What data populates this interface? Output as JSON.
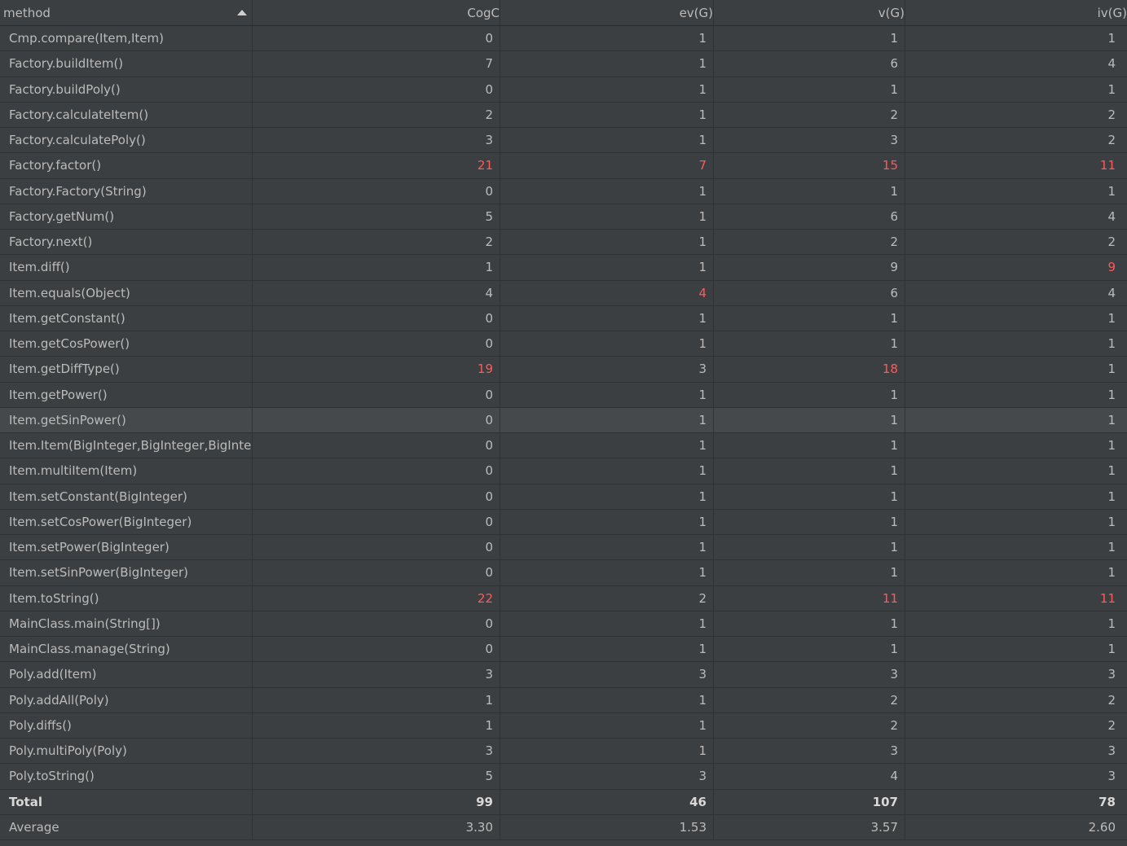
{
  "header": {
    "columns": [
      "method",
      "CogC",
      "ev(G)",
      "v(G)",
      "iv(G)"
    ]
  },
  "colors": {
    "background": "#3c3f41",
    "text": "#bbbbbb",
    "highlight": "#ff5a5a",
    "accent": "#4a88c7"
  },
  "rows": [
    {
      "method": "Cmp.compare(Item,Item)",
      "cogc": "0",
      "ev": "1",
      "v": "1",
      "iv": "1"
    },
    {
      "method": "Factory.buildItem()",
      "cogc": "7",
      "ev": "1",
      "v": "6",
      "iv": "4"
    },
    {
      "method": "Factory.buildPoly()",
      "cogc": "0",
      "ev": "1",
      "v": "1",
      "iv": "1"
    },
    {
      "method": "Factory.calculateItem()",
      "cogc": "2",
      "ev": "1",
      "v": "2",
      "iv": "2"
    },
    {
      "method": "Factory.calculatePoly()",
      "cogc": "3",
      "ev": "1",
      "v": "3",
      "iv": "2"
    },
    {
      "method": "Factory.factor()",
      "cogc": "21",
      "ev": "7",
      "v": "15",
      "iv": "11",
      "red": [
        "cogc",
        "ev",
        "v",
        "iv"
      ]
    },
    {
      "method": "Factory.Factory(String)",
      "cogc": "0",
      "ev": "1",
      "v": "1",
      "iv": "1"
    },
    {
      "method": "Factory.getNum()",
      "cogc": "5",
      "ev": "1",
      "v": "6",
      "iv": "4"
    },
    {
      "method": "Factory.next()",
      "cogc": "2",
      "ev": "1",
      "v": "2",
      "iv": "2"
    },
    {
      "method": "Item.diff()",
      "cogc": "1",
      "ev": "1",
      "v": "9",
      "iv": "9",
      "red": [
        "iv"
      ]
    },
    {
      "method": "Item.equals(Object)",
      "cogc": "4",
      "ev": "4",
      "v": "6",
      "iv": "4",
      "red": [
        "ev"
      ]
    },
    {
      "method": "Item.getConstant()",
      "cogc": "0",
      "ev": "1",
      "v": "1",
      "iv": "1"
    },
    {
      "method": "Item.getCosPower()",
      "cogc": "0",
      "ev": "1",
      "v": "1",
      "iv": "1"
    },
    {
      "method": "Item.getDiffType()",
      "cogc": "19",
      "ev": "3",
      "v": "18",
      "iv": "1",
      "red": [
        "cogc",
        "v"
      ]
    },
    {
      "method": "Item.getPower()",
      "cogc": "0",
      "ev": "1",
      "v": "1",
      "iv": "1"
    },
    {
      "method": "Item.getSinPower()",
      "cogc": "0",
      "ev": "1",
      "v": "1",
      "iv": "1",
      "selected": true
    },
    {
      "method": "Item.Item(BigInteger,BigInteger,BigInteger,BigInteger)",
      "cogc": "0",
      "ev": "1",
      "v": "1",
      "iv": "1"
    },
    {
      "method": "Item.multiItem(Item)",
      "cogc": "0",
      "ev": "1",
      "v": "1",
      "iv": "1"
    },
    {
      "method": "Item.setConstant(BigInteger)",
      "cogc": "0",
      "ev": "1",
      "v": "1",
      "iv": "1"
    },
    {
      "method": "Item.setCosPower(BigInteger)",
      "cogc": "0",
      "ev": "1",
      "v": "1",
      "iv": "1"
    },
    {
      "method": "Item.setPower(BigInteger)",
      "cogc": "0",
      "ev": "1",
      "v": "1",
      "iv": "1"
    },
    {
      "method": "Item.setSinPower(BigInteger)",
      "cogc": "0",
      "ev": "1",
      "v": "1",
      "iv": "1"
    },
    {
      "method": "Item.toString()",
      "cogc": "22",
      "ev": "2",
      "v": "11",
      "iv": "11",
      "red": [
        "cogc",
        "v",
        "iv"
      ]
    },
    {
      "method": "MainClass.main(String[])",
      "cogc": "0",
      "ev": "1",
      "v": "1",
      "iv": "1"
    },
    {
      "method": "MainClass.manage(String)",
      "cogc": "0",
      "ev": "1",
      "v": "1",
      "iv": "1"
    },
    {
      "method": "Poly.add(Item)",
      "cogc": "3",
      "ev": "3",
      "v": "3",
      "iv": "3"
    },
    {
      "method": "Poly.addAll(Poly)",
      "cogc": "1",
      "ev": "1",
      "v": "2",
      "iv": "2"
    },
    {
      "method": "Poly.diffs()",
      "cogc": "1",
      "ev": "1",
      "v": "2",
      "iv": "2"
    },
    {
      "method": "Poly.multiPoly(Poly)",
      "cogc": "3",
      "ev": "1",
      "v": "3",
      "iv": "3"
    },
    {
      "method": "Poly.toString()",
      "cogc": "5",
      "ev": "3",
      "v": "4",
      "iv": "3"
    }
  ],
  "summary": [
    {
      "method": "Total",
      "cogc": "99",
      "ev": "46",
      "v": "107",
      "iv": "78",
      "bold": true
    },
    {
      "method": "Average",
      "cogc": "3.30",
      "ev": "1.53",
      "v": "3.57",
      "iv": "2.60"
    }
  ]
}
